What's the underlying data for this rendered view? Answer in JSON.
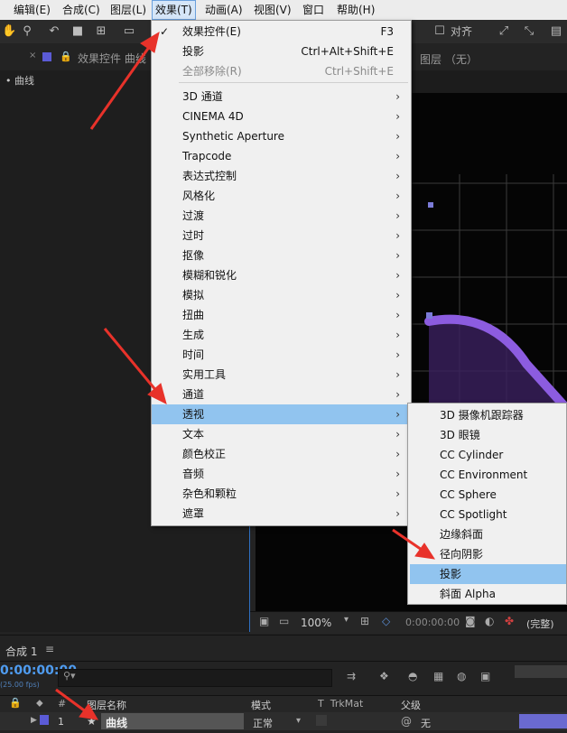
{
  "menubar": {
    "items": [
      "编辑(E)",
      "合成(C)",
      "图层(L)",
      "效果(T)",
      "动画(A)",
      "视图(V)",
      "窗口",
      "帮助(H)"
    ],
    "active": "效果(T)"
  },
  "toolbar": {
    "align_label": "对齐"
  },
  "left_panel": {
    "tab_label": "效果控件 曲线",
    "layer_label": "• 曲线"
  },
  "viewer": {
    "layer_tab": "图层 （无）",
    "zoom": "100%",
    "timecode": "0:00:00:00",
    "quality": "(完整)"
  },
  "effect_menu": {
    "items": [
      {
        "label": "效果控件(E)",
        "shortcut": "F3",
        "checked": true
      },
      {
        "label": "投影",
        "shortcut": "Ctrl+Alt+Shift+E"
      },
      {
        "label": "全部移除(R)",
        "shortcut": "Ctrl+Shift+E",
        "disabled": true
      },
      {
        "label": "3D 通道",
        "submenu": true
      },
      {
        "label": "CINEMA 4D",
        "submenu": true
      },
      {
        "label": "Synthetic Aperture",
        "submenu": true
      },
      {
        "label": "Trapcode",
        "submenu": true
      },
      {
        "label": "表达式控制",
        "submenu": true
      },
      {
        "label": "风格化",
        "submenu": true
      },
      {
        "label": "过渡",
        "submenu": true
      },
      {
        "label": "过时",
        "submenu": true
      },
      {
        "label": "抠像",
        "submenu": true
      },
      {
        "label": "模糊和锐化",
        "submenu": true
      },
      {
        "label": "模拟",
        "submenu": true
      },
      {
        "label": "扭曲",
        "submenu": true
      },
      {
        "label": "生成",
        "submenu": true
      },
      {
        "label": "时间",
        "submenu": true
      },
      {
        "label": "实用工具",
        "submenu": true
      },
      {
        "label": "通道",
        "submenu": true
      },
      {
        "label": "透视",
        "submenu": true,
        "highlighted": true
      },
      {
        "label": "文本",
        "submenu": true
      },
      {
        "label": "颜色校正",
        "submenu": true
      },
      {
        "label": "音频",
        "submenu": true
      },
      {
        "label": "杂色和颗粒",
        "submenu": true
      },
      {
        "label": "遮罩",
        "submenu": true
      }
    ],
    "submenu_arrow": "›",
    "check_mark": "✓"
  },
  "perspective_submenu": {
    "items": [
      {
        "label": "3D 摄像机跟踪器"
      },
      {
        "label": "3D 眼镜"
      },
      {
        "label": "CC Cylinder"
      },
      {
        "label": "CC Environment"
      },
      {
        "label": "CC Sphere"
      },
      {
        "label": "CC Spotlight"
      },
      {
        "label": "边缘斜面"
      },
      {
        "label": "径向阴影"
      },
      {
        "label": "投影",
        "highlighted": true
      },
      {
        "label": "斜面 Alpha"
      }
    ]
  },
  "timeline": {
    "comp_tab": "合成 1",
    "timecode": "0:00:00:00",
    "fps": "(25.00 fps)",
    "columns": {
      "layer_name": "图层名称",
      "mode": "模式",
      "trkmat": "TrkMat",
      "parent": "父级"
    },
    "layer": {
      "index": "1",
      "name": "曲线",
      "mode": "正常",
      "parent": "无"
    }
  },
  "colors": {
    "accent_blue": "#2e6fc2",
    "menu_highlight": "#91c4ef",
    "curve_purple": "#8c5ce0",
    "annotation_red": "#e8322a"
  }
}
